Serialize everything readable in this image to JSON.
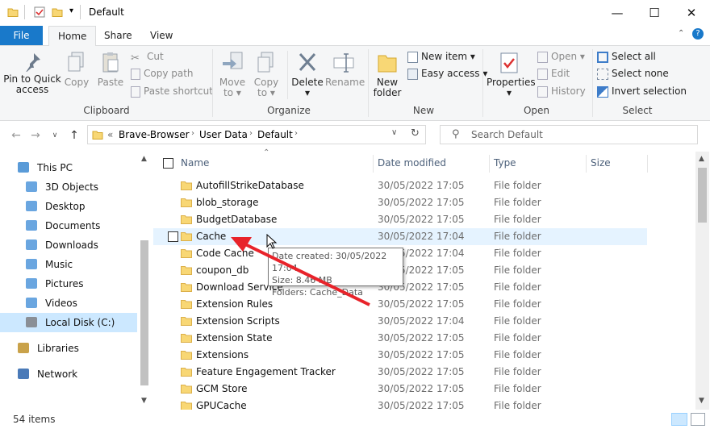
{
  "window": {
    "title": "Default",
    "minimize_icon": "minimize-icon",
    "maximize_icon": "maximize-icon",
    "close_icon": "close-icon"
  },
  "ribbon_tabs": [
    "File",
    "Home",
    "Share",
    "View"
  ],
  "ribbon": {
    "clipboard": {
      "label": "Clipboard",
      "pin": "Pin to Quick access",
      "pin_line1": "Pin to Quick",
      "pin_line2": "access",
      "copy": "Copy",
      "paste": "Paste",
      "cut": "Cut",
      "copy_path": "Copy path",
      "paste_shortcut": "Paste shortcut"
    },
    "organize": {
      "label": "Organize",
      "move_to": "Move",
      "move_to2": "to",
      "copy_to": "Copy",
      "copy_to2": "to",
      "delete": "Delete",
      "rename": "Rename"
    },
    "new": {
      "label": "New",
      "new_folder1": "New",
      "new_folder2": "folder",
      "new_item": "New item",
      "easy_access": "Easy access"
    },
    "open": {
      "label": "Open",
      "properties": "Properties",
      "open": "Open",
      "edit": "Edit",
      "history": "History"
    },
    "select": {
      "label": "Select",
      "select_all": "Select all",
      "select_none": "Select none",
      "invert": "Invert selection"
    }
  },
  "address": {
    "overflow": "«",
    "crumbs": [
      "Brave-Browser",
      "User Data",
      "Default"
    ],
    "search_placeholder": "Search Default"
  },
  "nav_pane": [
    {
      "label": "This PC",
      "icon": "pc-icon"
    },
    {
      "label": "3D Objects",
      "icon": "3d-objects-icon"
    },
    {
      "label": "Desktop",
      "icon": "desktop-icon"
    },
    {
      "label": "Documents",
      "icon": "documents-icon"
    },
    {
      "label": "Downloads",
      "icon": "downloads-icon"
    },
    {
      "label": "Music",
      "icon": "music-icon"
    },
    {
      "label": "Pictures",
      "icon": "pictures-icon"
    },
    {
      "label": "Videos",
      "icon": "videos-icon"
    },
    {
      "label": "Local Disk (C:)",
      "icon": "drive-icon"
    },
    {
      "label": "Libraries",
      "icon": "libraries-icon"
    },
    {
      "label": "Network",
      "icon": "network-icon"
    }
  ],
  "columns": {
    "name": "Name",
    "date": "Date modified",
    "type": "Type",
    "size": "Size"
  },
  "files": [
    {
      "name": "AutofillStrikeDatabase",
      "date": "30/05/2022 17:05",
      "type": "File folder"
    },
    {
      "name": "blob_storage",
      "date": "30/05/2022 17:05",
      "type": "File folder"
    },
    {
      "name": "BudgetDatabase",
      "date": "30/05/2022 17:05",
      "type": "File folder"
    },
    {
      "name": "Cache",
      "date": "30/05/2022 17:04",
      "type": "File folder"
    },
    {
      "name": "Code Cache",
      "date": "30/05/2022 17:04",
      "type": "File folder"
    },
    {
      "name": "coupon_db",
      "date": "30/05/2022 17:05",
      "type": "File folder"
    },
    {
      "name": "Download Service",
      "date": "30/05/2022 17:05",
      "type": "File folder"
    },
    {
      "name": "Extension Rules",
      "date": "30/05/2022 17:05",
      "type": "File folder"
    },
    {
      "name": "Extension Scripts",
      "date": "30/05/2022 17:04",
      "type": "File folder"
    },
    {
      "name": "Extension State",
      "date": "30/05/2022 17:05",
      "type": "File folder"
    },
    {
      "name": "Extensions",
      "date": "30/05/2022 17:05",
      "type": "File folder"
    },
    {
      "name": "Feature Engagement Tracker",
      "date": "30/05/2022 17:05",
      "type": "File folder"
    },
    {
      "name": "GCM Store",
      "date": "30/05/2022 17:05",
      "type": "File folder"
    },
    {
      "name": "GPUCache",
      "date": "30/05/2022 17:05",
      "type": "File folder"
    }
  ],
  "tooltip": {
    "line1": "Date created: 30/05/2022 17:04",
    "line2": "Size: 8.46 MB",
    "line3": "Folders: Cache_Data"
  },
  "status": {
    "items": "54 items"
  },
  "colors": {
    "accent": "#1979ca",
    "arrow": "#e8232a",
    "folder": "#f8d775",
    "hover": "#e5f3ff",
    "selected": "#cce8ff"
  }
}
